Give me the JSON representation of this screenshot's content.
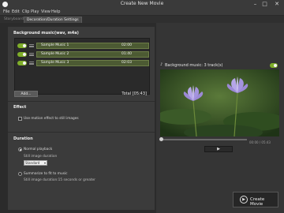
{
  "window": {
    "title": "Create New Movie"
  },
  "menu": [
    "File",
    "Edit",
    "Clip",
    "Play",
    "View",
    "Help"
  ],
  "tabs": [
    {
      "label": "Storyboard",
      "active": false
    },
    {
      "label": "Decoration/Duration Settings",
      "active": true
    }
  ],
  "music": {
    "section_title": "Background music(wav, m4a)",
    "tracks": [
      {
        "name": "Sample Music 1",
        "duration": "02:00",
        "enabled": true
      },
      {
        "name": "Sample Music 2",
        "duration": "01:40",
        "enabled": true
      },
      {
        "name": "Sample Music 3",
        "duration": "02:03",
        "enabled": true
      }
    ],
    "add_label": "Add...",
    "total": "Total [05:43]"
  },
  "effect": {
    "section_title": "Effect",
    "motion_label": "Use motion effect to still images",
    "motion_checked": false
  },
  "duration": {
    "section_title": "Duration",
    "normal_label": "Normal playback",
    "still_label": "Still image duration",
    "still_value": "Standard",
    "summarize_label": "Summarize to fit to music",
    "summarize_note": "Still image duration:15 seconds or greater",
    "selected": "normal"
  },
  "preview": {
    "bg_music_label": "Background music: 3 track(s)",
    "timecode": "00:00 / 05:43",
    "play_icon": "play-icon"
  },
  "create": {
    "label": "Create Movie"
  },
  "colors": {
    "accent": "#7fae29",
    "panel": "#3b3b3b",
    "background": "#2b2b2b"
  }
}
